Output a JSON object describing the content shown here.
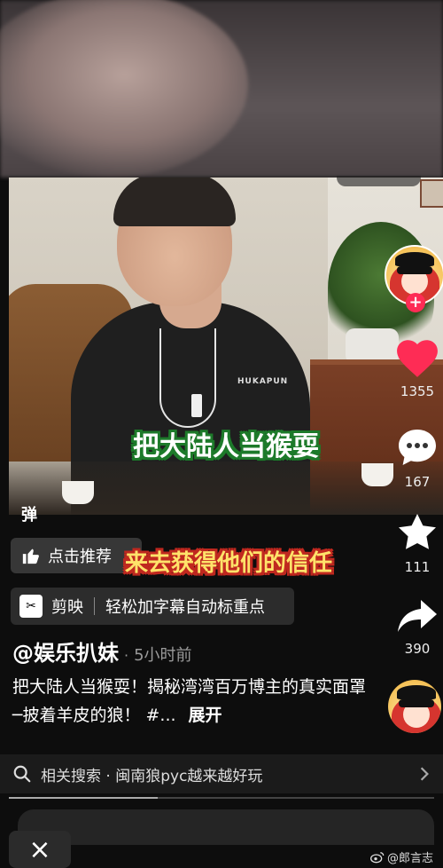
{
  "video": {
    "caption_top": "把大陆人当猴耍",
    "caption_bottom": "来去获得他们的信任",
    "danmu_label": "弹",
    "shirt_text": "HUKAPUN"
  },
  "actions": {
    "recommend_label": "点击推荐",
    "like_count": "1355",
    "comment_count": "167",
    "favorite_count": "111",
    "share_count": "390",
    "follow_symbol": "+"
  },
  "capcut": {
    "logo_text": "✂",
    "name": "剪映",
    "desc": "轻松加字幕自动标重点"
  },
  "post": {
    "author": "@娱乐扒妹",
    "dot": "·",
    "time": "5小时前",
    "description": "把大陆人当猴耍！揭秘湾湾百万博主的真实面罩─披着羊皮的狼！ #...",
    "expand": "展开"
  },
  "search": {
    "text": "相关搜索 · 闽南狼pyc越来越好玩"
  },
  "progress": {
    "fraction": 0.35
  },
  "close_symbol": "×",
  "watermark": "@郎言志",
  "colors": {
    "like_red": "#fe2c55",
    "caption_green": "#1d7a2a",
    "caption_red": "#c0281f",
    "caption_yellow": "#ffe36a"
  }
}
